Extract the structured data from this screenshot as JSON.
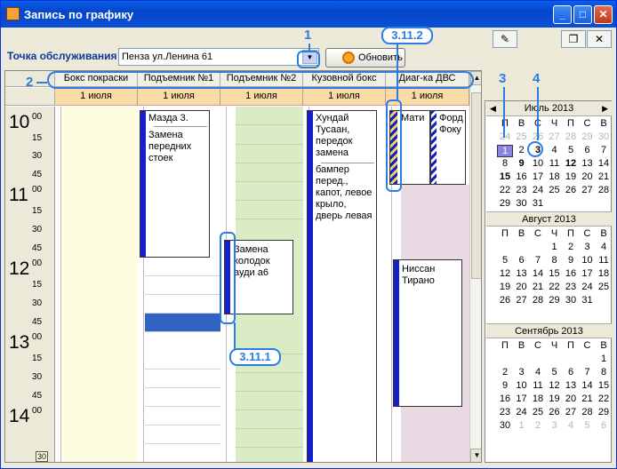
{
  "title": "Запись по графику",
  "point_label": "Точка обслуживания",
  "point_value": "Пенза ул.Ленина 61",
  "refresh_label": "Обновить",
  "columns": [
    {
      "name": "Бокс покраски",
      "date": "1 июля"
    },
    {
      "name": "Подъемник №1",
      "date": "1 июля"
    },
    {
      "name": "Подъемник №2",
      "date": "1 июля"
    },
    {
      "name": "Кузовной бокс",
      "date": "1 июля"
    },
    {
      "name": "Диаг-ка ДВС",
      "date": "1 июля"
    }
  ],
  "times": [
    {
      "h": "10",
      "m": [
        "00",
        "15",
        "30",
        "45"
      ]
    },
    {
      "h": "11",
      "m": [
        "00",
        "15",
        "30",
        "45"
      ]
    },
    {
      "h": "12",
      "m": [
        "00",
        "15",
        "30",
        "45"
      ]
    },
    {
      "h": "13",
      "m": [
        "00",
        "15",
        "30",
        "45"
      ]
    },
    {
      "h": "14",
      "m": [
        "00"
      ]
    }
  ],
  "time_foot": "30",
  "appointments": {
    "lift1": "Мазда 3.",
    "lift1_note": "Замена передних стоек",
    "lift2": "Замена колодок ауди а6",
    "body1": "Хундай Тусаан, передок замена",
    "body1_note": "бампер перед., капот, левое крыло, дверь левая",
    "diag1": "Мати",
    "diag2": "Форд Фоку",
    "diag3": "Ниссан Тирано"
  },
  "annotations": {
    "a1": "1",
    "a2": "2",
    "a3": "3",
    "a4": "4",
    "a311": "3.11.1",
    "a312": "3.11.2"
  },
  "calendar": [
    {
      "title": "Июль 2013",
      "dows": [
        "П",
        "В",
        "С",
        "Ч",
        "П",
        "С",
        "В"
      ],
      "weeks": [
        [
          "24",
          "25",
          "26",
          "27",
          "28",
          "29",
          "30"
        ],
        [
          "1",
          "2",
          "3",
          "4",
          "5",
          "6",
          "7"
        ],
        [
          "8",
          "9",
          "10",
          "11",
          "12",
          "13",
          "14"
        ],
        [
          "15",
          "16",
          "17",
          "18",
          "19",
          "20",
          "21"
        ],
        [
          "22",
          "23",
          "24",
          "25",
          "26",
          "27",
          "28"
        ],
        [
          "29",
          "30",
          "31",
          "",
          "",
          "",
          ""
        ]
      ]
    },
    {
      "title": "Август 2013",
      "dows": [
        "П",
        "В",
        "С",
        "Ч",
        "П",
        "С",
        "В"
      ],
      "weeks": [
        [
          "",
          "",
          "",
          "1",
          "2",
          "3",
          "4"
        ],
        [
          "5",
          "6",
          "7",
          "8",
          "9",
          "10",
          "11"
        ],
        [
          "12",
          "13",
          "14",
          "15",
          "16",
          "17",
          "18"
        ],
        [
          "19",
          "20",
          "21",
          "22",
          "23",
          "24",
          "25"
        ],
        [
          "26",
          "27",
          "28",
          "29",
          "30",
          "31",
          ""
        ]
      ]
    },
    {
      "title": "Сентябрь 2013",
      "dows": [
        "П",
        "В",
        "С",
        "Ч",
        "П",
        "С",
        "В"
      ],
      "weeks": [
        [
          "",
          "",
          "",
          "",
          "",
          "",
          "1"
        ],
        [
          "2",
          "3",
          "4",
          "5",
          "6",
          "7",
          "8"
        ],
        [
          "9",
          "10",
          "11",
          "12",
          "13",
          "14",
          "15"
        ],
        [
          "16",
          "17",
          "18",
          "19",
          "20",
          "21",
          "22"
        ],
        [
          "23",
          "24",
          "25",
          "26",
          "27",
          "28",
          "29"
        ],
        [
          "30",
          "1",
          "2",
          "3",
          "4",
          "5",
          "6"
        ]
      ]
    }
  ]
}
